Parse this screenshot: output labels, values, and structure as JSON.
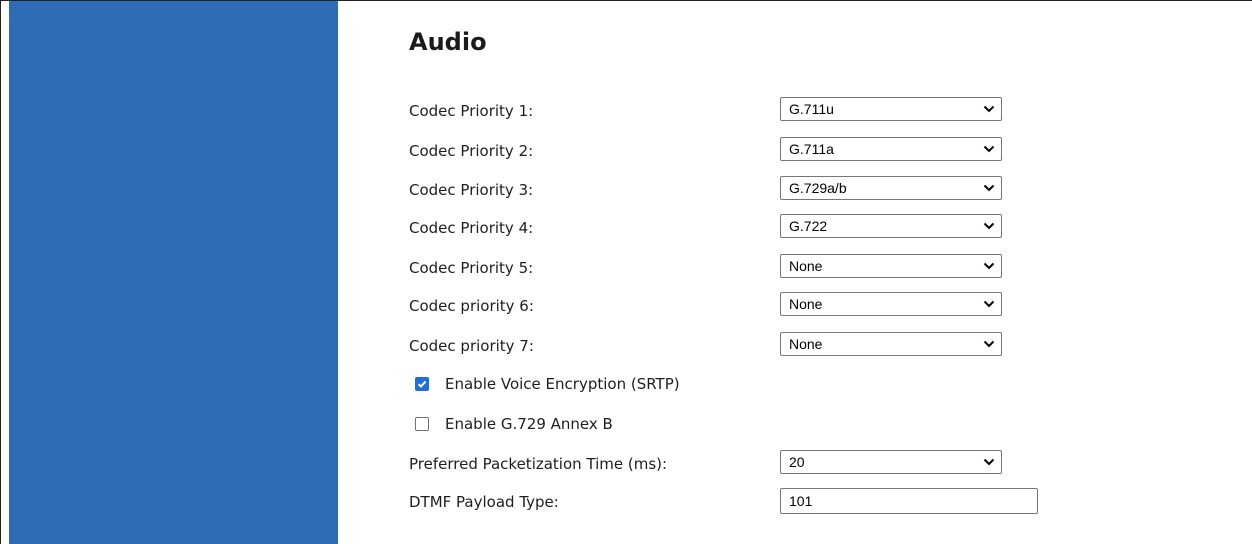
{
  "section": {
    "title": "Audio"
  },
  "codecs": [
    {
      "label": "Codec Priority 1:",
      "value": "G.711u"
    },
    {
      "label": "Codec Priority 2:",
      "value": "G.711a"
    },
    {
      "label": "Codec Priority 3:",
      "value": "G.729a/b"
    },
    {
      "label": "Codec Priority 4:",
      "value": "G.722"
    },
    {
      "label": "Codec Priority 5:",
      "value": "None"
    },
    {
      "label": "Codec priority 6:",
      "value": "None"
    },
    {
      "label": "Codec priority 7:",
      "value": "None"
    }
  ],
  "options": {
    "srtp": {
      "label": "Enable Voice Encryption (SRTP)",
      "checked": true
    },
    "annex_b": {
      "label": "Enable G.729 Annex B",
      "checked": false
    }
  },
  "packetization": {
    "label": "Preferred Packetization Time (ms):",
    "value": "20"
  },
  "dtmf": {
    "label": "DTMF Payload Type:",
    "value": "101"
  },
  "colors": {
    "sidebar": "#2e6db5",
    "checkbox_accent": "#1f6fd6"
  },
  "icons": {
    "dropdown": "chevron-down-icon",
    "check": "checkmark-icon"
  }
}
